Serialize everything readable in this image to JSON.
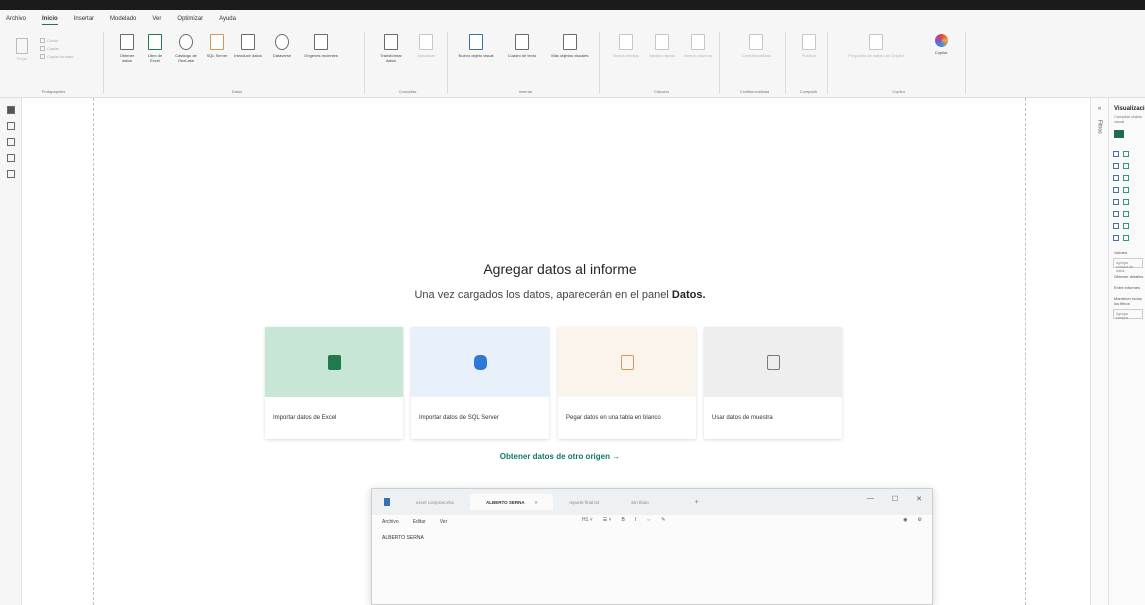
{
  "menu": {
    "items": [
      "Archivo",
      "Inicio",
      "Insertar",
      "Modelado",
      "Ver",
      "Optimizar",
      "Ayuda"
    ],
    "active": "Inicio"
  },
  "ribbon": {
    "clipboard": {
      "label": "Portapapeles",
      "paste": "Pegar",
      "cut": "Cortar",
      "copy": "Copiar",
      "format": "Copiar formato"
    },
    "data": {
      "label": "Datos",
      "buttons": [
        "Obtener datos",
        "Libro de Excel",
        "Catálogo de OneLake",
        "SQL Server",
        "Introducir datos",
        "Dataverse",
        "Orígenes recientes"
      ]
    },
    "queries": {
      "label": "Consultas",
      "buttons": [
        "Transformar datos",
        "Actualizar"
      ]
    },
    "insert": {
      "label": "Insertar",
      "buttons": [
        "Nuevo objeto visual",
        "Cuadro de texto",
        "Más objetos visuales"
      ]
    },
    "calc": {
      "label": "Cálculos",
      "buttons": [
        "Nueva medida",
        "Medida rápida",
        "Nueva columna"
      ]
    },
    "sensitivity": {
      "label": "Confidencialidad",
      "buttons": [
        "Confidencialidad"
      ]
    },
    "share": {
      "label": "Compartir",
      "buttons": [
        "Publicar"
      ]
    },
    "copilot": {
      "label": "Copilot",
      "buttons": [
        "Preguntas de datos con Copilot",
        "Copilot"
      ]
    }
  },
  "canvas": {
    "heading": "Agregar datos al informe",
    "subheading_prefix": "Una vez cargados los datos, aparecerán en el panel",
    "subheading_bold": "Datos.",
    "cards": [
      {
        "label": "Importar datos de Excel",
        "bg": "#c8e6d6",
        "icon_color": "#1f7a4d"
      },
      {
        "label": "Importar datos de SQL Server",
        "bg": "#e8f1fb",
        "icon_color": "#2f79d6"
      },
      {
        "label": "Pegar datos en una tabla en blanco",
        "bg": "#fbf4ec",
        "icon_color": "#d29a5a"
      },
      {
        "label": "Usar datos de muestra",
        "bg": "#efeeee",
        "icon_color": "#7a7a7a"
      }
    ],
    "other_source_link": "Obtener datos de otro origen →"
  },
  "notepad": {
    "tabs": [
      "excel compras.xlsx",
      "ALBERTO SERNA",
      "reporte final.txt",
      "Sin título"
    ],
    "active_tab": "ALBERTO SERNA",
    "menu": [
      "Archivo",
      "Editar",
      "Ver"
    ],
    "format": [
      "H1 ˅",
      "☰ ˅",
      "B",
      "I",
      "⇔",
      "✎"
    ],
    "content": "ALBERTO SERNA"
  },
  "right_pane": {
    "filters_label": "Filtros",
    "visualizations_title": "Visualizaciones",
    "visualizations_sub": "Compilar objeto visual",
    "values_label": "Valores",
    "values_placeholder": "Agregar campos de datos",
    "drill_label": "Obtener detalles",
    "cross_report": "Entre informes",
    "keep_filters": "Mantener todos los filtros",
    "add_drill": "Agregar campos"
  }
}
